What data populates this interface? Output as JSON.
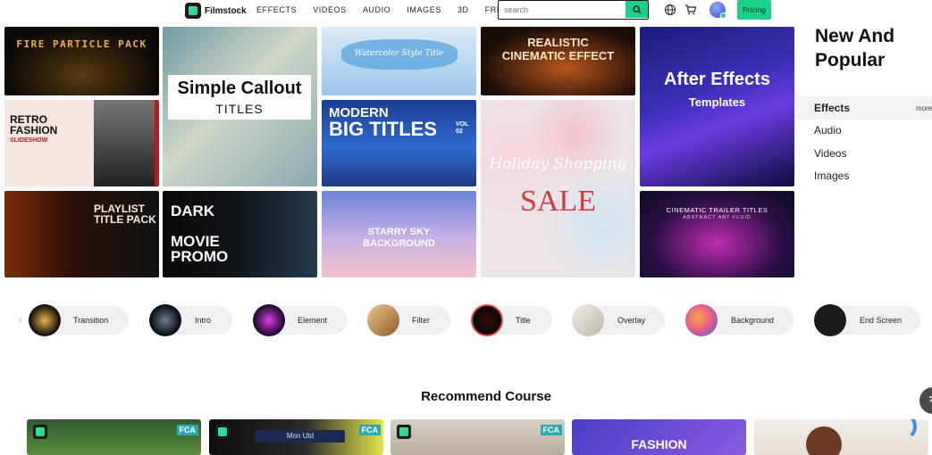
{
  "header": {
    "logo_text": "Filmstock",
    "nav": [
      "EFFECTS",
      "VIDEOS",
      "AUDIO",
      "IMAGES",
      "3D",
      "FREE"
    ],
    "search_placeholder": "search",
    "pricing_label": "Pricing"
  },
  "tiles": {
    "fire": "FIRE PARTICLE PACK",
    "callout_main": "Simple Callout",
    "callout_sub": "TITLES",
    "watercolor": "Watercolor Style Title",
    "cinematic": "REALISTIC\nCINEMATIC EFFECT",
    "after_effects_main": "After Effects",
    "after_effects_sub": "Templates",
    "retro": "RETRO\nFASHION",
    "retro_sub": "SLIDESHOW",
    "modern": "MODERN",
    "big_titles": "BIG TITLES",
    "vol": "VOL\n02",
    "holiday": "Holiday Shopping",
    "sale": "SALE",
    "playlist": "PLAYLIST\nTITLE PACK",
    "dark_movie": "DARK\n\nMOVIE\nPROMO",
    "starry": "STARRY SKY\nBACKGROUND",
    "trailer": "CINEMATIC TRAILER TITLES",
    "trailer_sub": "ABSTRACT ART FLUID"
  },
  "sidebar": {
    "title": "New And Popular",
    "items": [
      "Effects",
      "Audio",
      "Videos",
      "Images"
    ],
    "more": "more"
  },
  "categories": [
    "Transition",
    "Intro",
    "Element",
    "Filter",
    "Title",
    "Overlay",
    "Background",
    "End Screen"
  ],
  "recommend": {
    "title": "Recommend Course",
    "badge": "FCA",
    "card2_text": "Mon Utd",
    "card5_text": "FASHION"
  }
}
